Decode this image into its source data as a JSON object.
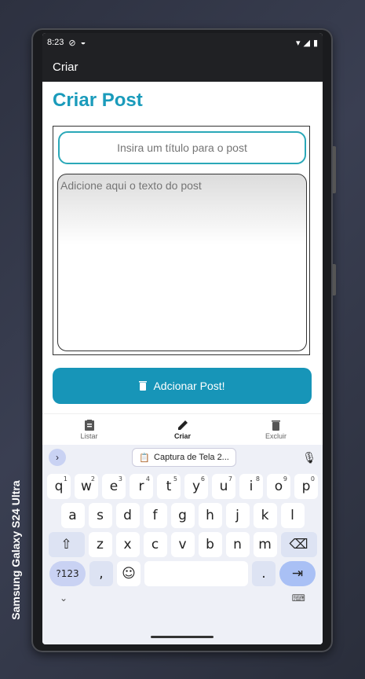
{
  "device": {
    "label": "Samsung Galaxy S24 Ultra"
  },
  "status": {
    "time": "8:23"
  },
  "appbar": {
    "title": "Criar"
  },
  "page": {
    "heading": "Criar Post"
  },
  "form": {
    "title_placeholder": "Insira um título para o post",
    "text_placeholder": "Adicione aqui o texto do post",
    "submit_label": "Adcionar Post!"
  },
  "nav": {
    "items": [
      {
        "label": "Listar",
        "icon": "clipboard-icon"
      },
      {
        "label": "Criar",
        "icon": "pencil-icon",
        "active": true
      },
      {
        "label": "Excluir",
        "icon": "trash-icon"
      }
    ]
  },
  "keyboard": {
    "clipboard_chip": "Captura de Tela 2...",
    "row1": [
      {
        "k": "q",
        "n": "1"
      },
      {
        "k": "w",
        "n": "2"
      },
      {
        "k": "e",
        "n": "3"
      },
      {
        "k": "r",
        "n": "4"
      },
      {
        "k": "t",
        "n": "5"
      },
      {
        "k": "y",
        "n": "6"
      },
      {
        "k": "u",
        "n": "7"
      },
      {
        "k": "i",
        "n": "8"
      },
      {
        "k": "o",
        "n": "9"
      },
      {
        "k": "p",
        "n": "0"
      }
    ],
    "row2": [
      "a",
      "s",
      "d",
      "f",
      "g",
      "h",
      "j",
      "k",
      "l"
    ],
    "row3": [
      "z",
      "x",
      "c",
      "v",
      "b",
      "n",
      "m"
    ],
    "sym_label": "?123",
    "comma": ",",
    "period": "."
  },
  "colors": {
    "accent": "#1a9bbb",
    "button": "#1795b8",
    "input_border": "#2aa8b8"
  }
}
